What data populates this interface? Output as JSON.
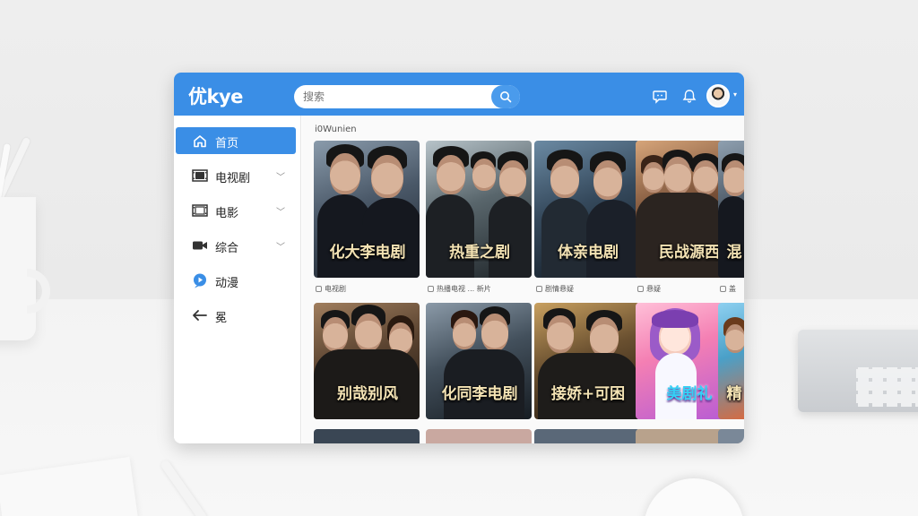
{
  "app": {
    "logo": "优kye"
  },
  "search": {
    "placeholder": "搜索",
    "value": "搜索"
  },
  "header_icons": [
    "chat-bubble-icon",
    "bell-icon",
    "user-avatar"
  ],
  "colors": {
    "accent": "#3a8ee6",
    "sidebar_bg": "#ffffff",
    "content_bg": "#fafafa"
  },
  "sidebar": {
    "items": [
      {
        "label": "首页",
        "icon": "home-icon",
        "active": true,
        "expandable": false
      },
      {
        "label": "电视剧",
        "icon": "film-strip-icon",
        "active": false,
        "expandable": true
      },
      {
        "label": "电影",
        "icon": "film-strip-icon",
        "active": false,
        "expandable": true
      },
      {
        "label": "综合",
        "icon": "video-camera-icon",
        "active": false,
        "expandable": true
      },
      {
        "label": "动漫",
        "icon": "chat-bubble-icon",
        "active": false,
        "expandable": false
      },
      {
        "label": "冕",
        "icon": "arrow-left-icon",
        "active": false,
        "expandable": false
      }
    ]
  },
  "main": {
    "section_title": "i0Wunien",
    "row1": [
      {
        "title": "化大李电剧",
        "subtitle": "",
        "caption": "电视剧"
      },
      {
        "title": "热重之剧",
        "subtitle": "",
        "caption": "热播电视 ...    新片"
      },
      {
        "title": "体亲电剧",
        "subtitle": "",
        "caption": "剧情悬疑"
      },
      {
        "title": "民战源西",
        "subtitle": "",
        "caption": "悬疑"
      },
      {
        "title": "混",
        "subtitle": "",
        "caption": "盖"
      }
    ],
    "row2": [
      {
        "title": "别哉别风",
        "subtitle": ""
      },
      {
        "title": "化同李电剧",
        "subtitle": ""
      },
      {
        "title": "接娇+可困",
        "subtitle": ""
      },
      {
        "title": "美剧礼",
        "subtitle": ""
      },
      {
        "title": "精",
        "subtitle": ""
      }
    ]
  }
}
